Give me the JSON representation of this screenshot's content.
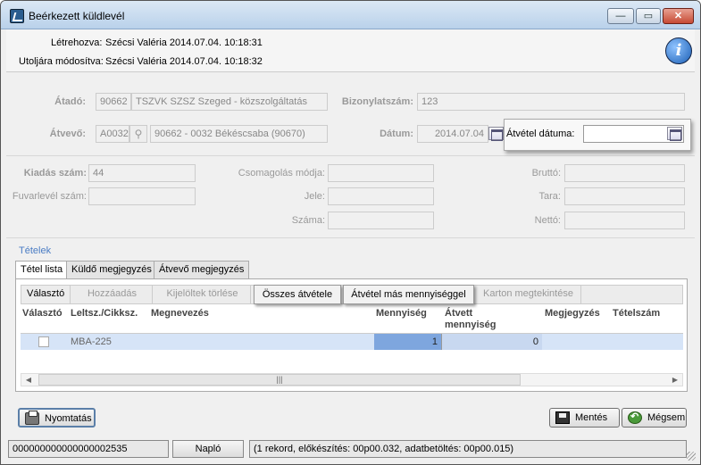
{
  "window": {
    "title": "Beérkezett küldlevél",
    "minimize": "—",
    "maximize": "▭",
    "close": "✕"
  },
  "header": {
    "created_label": "Létrehozva:",
    "created_value": "Szécsi Valéria 2014.07.04. 10:18:31",
    "modified_label": "Utoljára módosítva:",
    "modified_value": "Szécsi Valéria 2014.07.04. 10:18:32",
    "info": "i"
  },
  "form": {
    "atado_label": "Átadó:",
    "atado_code": "90662",
    "atado_name": "TSZVK SZSZ Szeged - közszolgáltatás",
    "bizonylat_label": "Bizonylatszám:",
    "bizonylat_value": "123",
    "atvevo_label": "Átvevő:",
    "atvevo_code": "A0032",
    "atvevo_name": "90662 - 0032 Békéscsaba (90670)",
    "datum_label": "Dátum:",
    "datum_value": "2014.07.04",
    "atvetel_datum_label": "Átvétel dátuma:",
    "atvetel_datum_value": ""
  },
  "details": {
    "kiadas_label": "Kiadás szám:",
    "kiadas_value": "44",
    "fuvarlevel_label": "Fuvarlevél szám:",
    "fuvarlevel_value": "",
    "csomagolas_label": "Csomagolás módja:",
    "csomagolas_value": "",
    "jele_label": "Jele:",
    "jele_value": "",
    "szama_label": "Száma:",
    "szama_value": "",
    "brutto_label": "Bruttó:",
    "brutto_value": "",
    "tara_label": "Tara:",
    "tara_value": "",
    "netto_label": "Nettó:",
    "netto_value": ""
  },
  "items": {
    "group_title": "Tételek",
    "tabs": [
      "Tétel lista",
      "Küldő megjegyzés",
      "Átvevő megjegyzés"
    ],
    "toolbar": [
      "Választó",
      "Hozzáadás",
      "Kijelöltek törlése",
      "Összes átvétele",
      "Átvétel más mennyiséggel",
      "Karton megtekintése"
    ],
    "columns": [
      "Választó",
      "Leltsz./Cikksz.",
      "Megnevezés",
      "Mennyiség",
      "Átvett mennyiség",
      "Megjegyzés",
      "Tételszám"
    ],
    "rows": [
      {
        "code": "MBA-225",
        "name": "",
        "mennyiseg": "1",
        "atvett": "0",
        "megjegyzes": "",
        "tetelszam": ""
      }
    ],
    "scroll_grip": "|||"
  },
  "actions": {
    "print": "Nyomtatás",
    "save": "Mentés",
    "cancel": "Mégsem"
  },
  "status": {
    "id": "000000000000000002535",
    "log_button": "Napló",
    "message": "(1 rekord, előkészítés: 00p00.032, adatbetöltés: 00p00.015)"
  }
}
